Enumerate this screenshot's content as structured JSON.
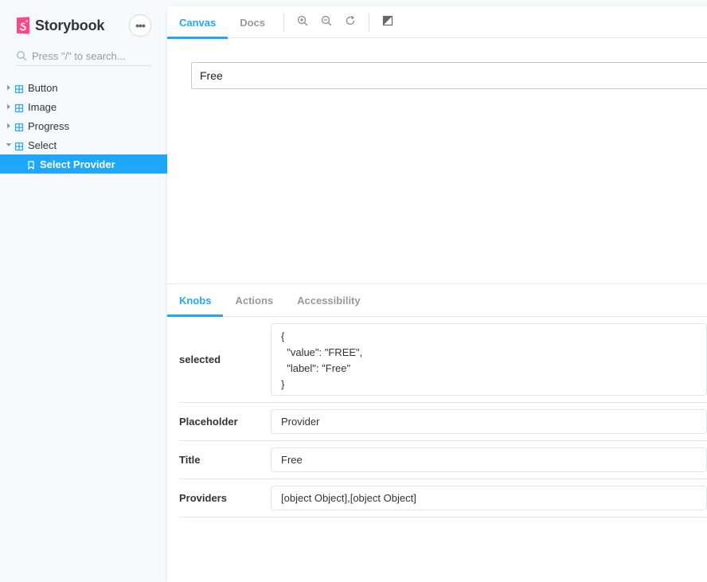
{
  "brand": {
    "name": "Storybook",
    "accent": "#ff4785"
  },
  "sidebar": {
    "menu_glyph": "•••",
    "search_placeholder": "Press \"/\" to search...",
    "items": [
      {
        "label": "Button",
        "expanded": false
      },
      {
        "label": "Image",
        "expanded": false
      },
      {
        "label": "Progress",
        "expanded": false
      },
      {
        "label": "Select",
        "expanded": true
      },
      {
        "label": "Select Provider",
        "selected": true
      }
    ]
  },
  "toolbar": {
    "tabs": [
      {
        "label": "Canvas",
        "active": true
      },
      {
        "label": "Docs",
        "active": false
      }
    ],
    "tools": [
      "zoom-in-icon",
      "zoom-out-icon",
      "zoom-reset-icon",
      "background-icon"
    ]
  },
  "canvas": {
    "select_value": "Free"
  },
  "addons": {
    "tabs": [
      {
        "label": "Knobs",
        "active": true
      },
      {
        "label": "Actions",
        "active": false
      },
      {
        "label": "Accessibility",
        "active": false
      }
    ],
    "knobs": [
      {
        "label": "selected",
        "json_lines": [
          "{",
          "  \"value\": \"FREE\",",
          "  \"label\": \"Free\"",
          "}"
        ]
      },
      {
        "label": "Placeholder",
        "value": "Provider"
      },
      {
        "label": "Title",
        "value": "Free"
      },
      {
        "label": "Providers",
        "value": "[object Object],[object Object]"
      }
    ]
  },
  "colors": {
    "primary": "#1ea7fd",
    "sidebar_bg": "#f6f9fc"
  }
}
